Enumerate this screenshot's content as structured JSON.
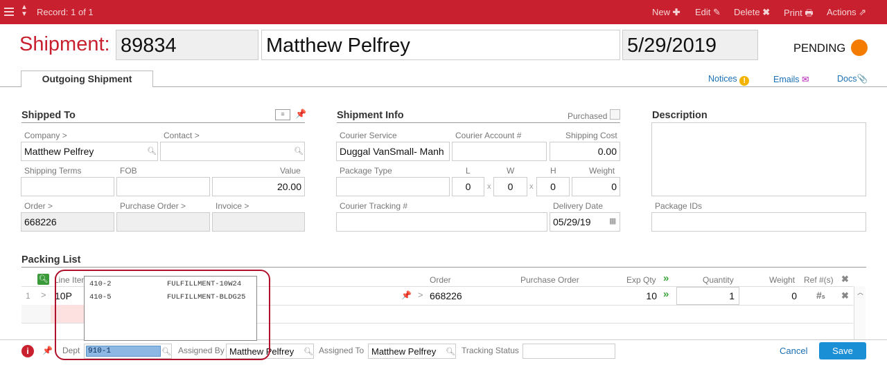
{
  "topbar": {
    "record_label": "Record: 1 of 1",
    "actions": [
      {
        "label": "New",
        "icon": "plus-icon"
      },
      {
        "label": "Edit",
        "icon": "pencil-icon"
      },
      {
        "label": "Delete",
        "icon": "x-icon"
      },
      {
        "label": "Print",
        "icon": "printer-icon"
      },
      {
        "label": "Actions",
        "icon": "arrow-out-icon"
      }
    ]
  },
  "header": {
    "title": "Shipment:",
    "number": "89834",
    "customer": "Matthew Pelfrey",
    "date": "5/29/2019",
    "status": "PENDING",
    "status_color": "#f47c00"
  },
  "tabs": {
    "active": "Outgoing Shipment"
  },
  "links": {
    "notices": "Notices",
    "emails": "Emails",
    "docs": "Docs"
  },
  "shipped_to": {
    "title": "Shipped To",
    "company_label": "Company >",
    "company": "Matthew Pelfrey",
    "contact_label": "Contact >",
    "contact": "",
    "shipping_terms_label": "Shipping Terms",
    "shipping_terms": "",
    "fob_label": "FOB",
    "fob": "",
    "value_label": "Value",
    "value": "20.00",
    "order_label": "Order >",
    "order": "668226",
    "purchase_order_label": "Purchase Order >",
    "purchase_order": "",
    "invoice_label": "Invoice >",
    "invoice": ""
  },
  "shipment_info": {
    "title": "Shipment Info",
    "purchased_label": "Purchased",
    "courier_service_label": "Courier Service",
    "courier_service": "Duggal VanSmall- Manh",
    "courier_account_label": "Courier Account #",
    "courier_account": "",
    "shipping_cost_label": "Shipping Cost",
    "shipping_cost": "0.00",
    "package_type_label": "Package Type",
    "package_type": "",
    "l_label": "L",
    "l": "0",
    "w_label": "W",
    "w": "0",
    "h_label": "H",
    "h": "0",
    "weight_label": "Weight",
    "weight": "0",
    "x": "x",
    "tracking_label": "Courier Tracking #",
    "tracking": "",
    "delivery_date_label": "Delivery Date",
    "delivery_date": "05/29/19"
  },
  "description": {
    "title": "Description",
    "text": "",
    "package_ids_label": "Package IDs",
    "package_ids": ""
  },
  "packing_list": {
    "title": "Packing List",
    "columns": {
      "line_item": "Line Item",
      "order": "Order",
      "purchase_order": "Purchase Order",
      "exp_qty": "Exp Qty",
      "quantity": "Quantity",
      "weight": "Weight",
      "refs": "Ref #(s)"
    },
    "rows": [
      {
        "num": "1",
        "item": "10P",
        "order": "668226",
        "purchase_order": "",
        "exp_qty": "10",
        "quantity": "1",
        "weight": "0"
      }
    ]
  },
  "dropdown": {
    "options": [
      {
        "code": "410-2",
        "name": "FULFILLMENT-10W24"
      },
      {
        "code": "410-5",
        "name": "FULFILLMENT-BLDG25"
      }
    ]
  },
  "footer": {
    "dept_label": "Dept",
    "dept_value": "910-1",
    "assigned_by_label": "Assigned By",
    "assigned_by": "Matthew Pelfrey",
    "assigned_to_label": "Assigned To",
    "assigned_to": "Matthew Pelfrey",
    "tracking_status_label": "Tracking Status",
    "tracking_status": "",
    "cancel_label": "Cancel",
    "save_label": "Save"
  }
}
